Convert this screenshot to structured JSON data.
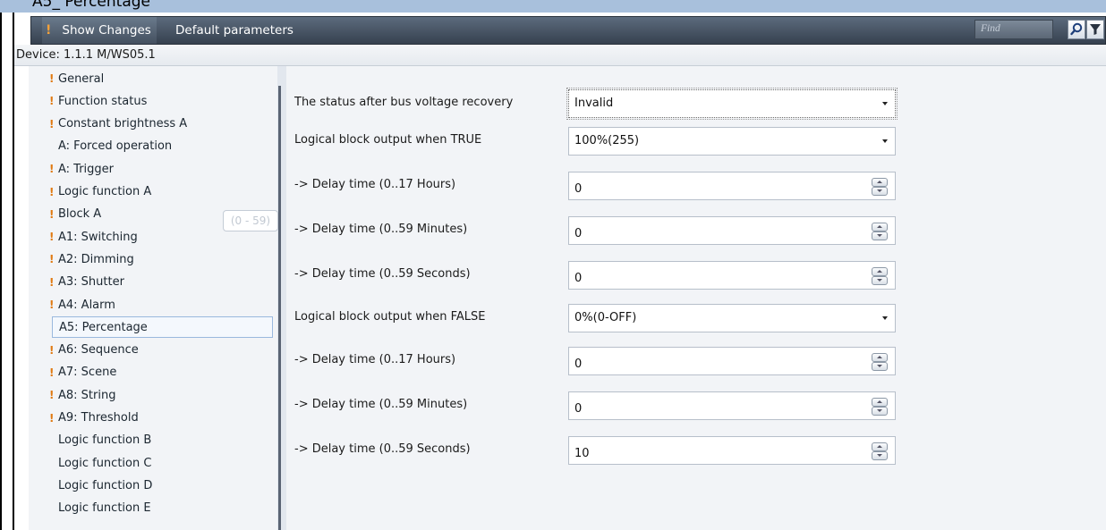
{
  "window": {
    "title_partial": "A5_ Percentage"
  },
  "toolbar": {
    "show_changes_label": "Show Changes",
    "default_parameters_label": "Default parameters",
    "find_placeholder": "Find",
    "find_icon": "search-icon",
    "filter_icon": "filter-icon"
  },
  "device": {
    "label": "Device: 1.1.1  M/WS05.1"
  },
  "tree": {
    "warning_glyph": "!",
    "items": [
      {
        "label": "General",
        "changed": true,
        "selected": false
      },
      {
        "label": "Function status",
        "changed": true,
        "selected": false
      },
      {
        "label": "Constant brightness A",
        "changed": true,
        "selected": false
      },
      {
        "label": "A: Forced operation",
        "changed": false,
        "selected": false
      },
      {
        "label": "A: Trigger",
        "changed": true,
        "selected": false
      },
      {
        "label": "Logic function A",
        "changed": true,
        "selected": false
      },
      {
        "label": "Block A",
        "changed": true,
        "selected": false
      },
      {
        "label": "A1: Switching",
        "changed": true,
        "selected": false
      },
      {
        "label": "A2: Dimming",
        "changed": true,
        "selected": false
      },
      {
        "label": "A3: Shutter",
        "changed": true,
        "selected": false
      },
      {
        "label": "A4: Alarm",
        "changed": true,
        "selected": false
      },
      {
        "label": "A5: Percentage",
        "changed": false,
        "selected": true
      },
      {
        "label": "A6: Sequence",
        "changed": true,
        "selected": false
      },
      {
        "label": "A7: Scene",
        "changed": true,
        "selected": false
      },
      {
        "label": "A8: String",
        "changed": true,
        "selected": false
      },
      {
        "label": "A9: Threshold",
        "changed": true,
        "selected": false
      },
      {
        "label": "Logic function B",
        "changed": false,
        "selected": false
      },
      {
        "label": "Logic function C",
        "changed": false,
        "selected": false
      },
      {
        "label": "Logic function D",
        "changed": false,
        "selected": false
      },
      {
        "label": "Logic function E",
        "changed": false,
        "selected": false
      }
    ]
  },
  "params": [
    {
      "label": "The status after bus voltage recovery",
      "type": "select",
      "value": "Invalid",
      "focused": true
    },
    {
      "label": "Logical block output when TRUE",
      "type": "select",
      "value": "100%(255)"
    },
    {
      "label": "-> Delay time (0..17 Hours)",
      "type": "number",
      "value": "0"
    },
    {
      "label": "-> Delay time (0..59 Minutes)",
      "type": "number",
      "value": "0"
    },
    {
      "label": "-> Delay time (0..59 Seconds)",
      "type": "number",
      "value": "0"
    },
    {
      "label": "Logical block output when FALSE",
      "type": "select",
      "value": "0%(0-OFF)"
    },
    {
      "label": "-> Delay time (0..17 Hours)",
      "type": "number",
      "value": "0"
    },
    {
      "label": "-> Delay time (0..59 Minutes)",
      "type": "number",
      "value": "0"
    },
    {
      "label": "-> Delay time (0..59 Seconds)",
      "type": "number",
      "value": "10"
    }
  ],
  "tooltip": {
    "text": "(0 - 59)"
  },
  "colors": {
    "toolbar_bg": "#3e4a59",
    "warning": "#e07a12",
    "selected_border": "#9ab9de",
    "panel_bg": "#f2f4f7"
  }
}
